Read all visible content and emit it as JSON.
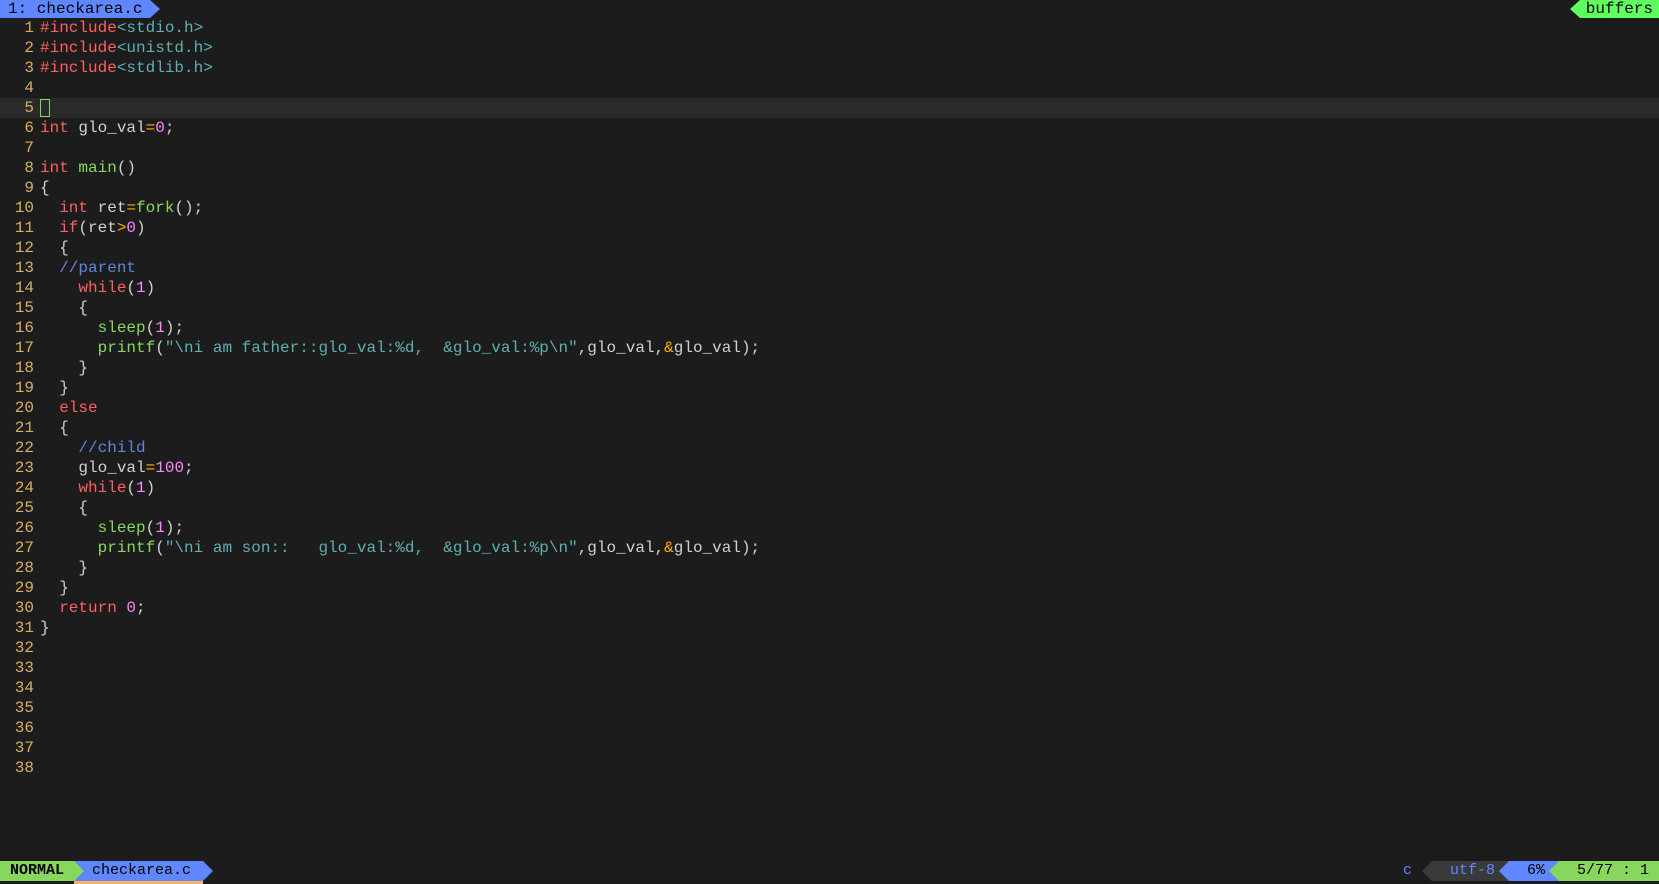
{
  "tabbar": {
    "active_tab": "1: checkarea.c",
    "buffers_label": "buffers"
  },
  "editor": {
    "current_line": 5,
    "lines": [
      {
        "n": 1,
        "tokens": [
          {
            "t": "#include",
            "c": "kw-pre"
          },
          {
            "t": "<stdio.h>",
            "c": "str"
          }
        ]
      },
      {
        "n": 2,
        "tokens": [
          {
            "t": "#include",
            "c": "kw-pre"
          },
          {
            "t": "<unistd.h>",
            "c": "str"
          }
        ]
      },
      {
        "n": 3,
        "tokens": [
          {
            "t": "#include",
            "c": "kw-pre"
          },
          {
            "t": "<stdlib.h>",
            "c": "str"
          }
        ]
      },
      {
        "n": 4,
        "tokens": []
      },
      {
        "n": 5,
        "cursor": true,
        "tokens": []
      },
      {
        "n": 6,
        "tokens": [
          {
            "t": "int",
            "c": "type"
          },
          {
            "t": " ",
            "c": "ident"
          },
          {
            "t": "glo_val",
            "c": "ident"
          },
          {
            "t": "=",
            "c": "op"
          },
          {
            "t": "0",
            "c": "num"
          },
          {
            "t": ";",
            "c": "punct"
          }
        ]
      },
      {
        "n": 7,
        "tokens": []
      },
      {
        "n": 8,
        "tokens": [
          {
            "t": "int",
            "c": "type"
          },
          {
            "t": " ",
            "c": "ident"
          },
          {
            "t": "main",
            "c": "func"
          },
          {
            "t": "()",
            "c": "punct"
          }
        ]
      },
      {
        "n": 9,
        "tokens": [
          {
            "t": "{",
            "c": "punct"
          }
        ]
      },
      {
        "n": 10,
        "tokens": [
          {
            "t": "  ",
            "c": "ident"
          },
          {
            "t": "int",
            "c": "type"
          },
          {
            "t": " ",
            "c": "ident"
          },
          {
            "t": "ret",
            "c": "ident"
          },
          {
            "t": "=",
            "c": "op"
          },
          {
            "t": "fork",
            "c": "func"
          },
          {
            "t": "();",
            "c": "punct"
          }
        ]
      },
      {
        "n": 11,
        "tokens": [
          {
            "t": "  ",
            "c": "ident"
          },
          {
            "t": "if",
            "c": "kw-pre"
          },
          {
            "t": "(ret",
            "c": "ident"
          },
          {
            "t": ">",
            "c": "op"
          },
          {
            "t": "0",
            "c": "num"
          },
          {
            "t": ")",
            "c": "punct"
          }
        ]
      },
      {
        "n": 12,
        "tokens": [
          {
            "t": "  {",
            "c": "punct"
          }
        ]
      },
      {
        "n": 13,
        "tokens": [
          {
            "t": "  ",
            "c": "ident"
          },
          {
            "t": "//parent",
            "c": "comment"
          }
        ]
      },
      {
        "n": 14,
        "tokens": [
          {
            "t": "    ",
            "c": "ident"
          },
          {
            "t": "while",
            "c": "kw-pre"
          },
          {
            "t": "(",
            "c": "punct"
          },
          {
            "t": "1",
            "c": "num"
          },
          {
            "t": ")",
            "c": "punct"
          }
        ]
      },
      {
        "n": 15,
        "tokens": [
          {
            "t": "    {",
            "c": "punct"
          }
        ]
      },
      {
        "n": 16,
        "tokens": [
          {
            "t": "      ",
            "c": "ident"
          },
          {
            "t": "sleep",
            "c": "func"
          },
          {
            "t": "(",
            "c": "punct"
          },
          {
            "t": "1",
            "c": "num"
          },
          {
            "t": ");",
            "c": "punct"
          }
        ]
      },
      {
        "n": 17,
        "tokens": [
          {
            "t": "      ",
            "c": "ident"
          },
          {
            "t": "printf",
            "c": "func"
          },
          {
            "t": "(",
            "c": "punct"
          },
          {
            "t": "\"\\ni am father::glo_val:%d,  &glo_val:%p\\n\"",
            "c": "str"
          },
          {
            "t": ",glo_val,",
            "c": "ident"
          },
          {
            "t": "&",
            "c": "op"
          },
          {
            "t": "glo_val);",
            "c": "ident"
          }
        ]
      },
      {
        "n": 18,
        "tokens": [
          {
            "t": "    }",
            "c": "punct"
          }
        ]
      },
      {
        "n": 19,
        "tokens": [
          {
            "t": "  }",
            "c": "punct"
          }
        ]
      },
      {
        "n": 20,
        "tokens": [
          {
            "t": "  ",
            "c": "ident"
          },
          {
            "t": "else",
            "c": "kw-pre"
          }
        ]
      },
      {
        "n": 21,
        "tokens": [
          {
            "t": "  {",
            "c": "punct"
          }
        ]
      },
      {
        "n": 22,
        "tokens": [
          {
            "t": "    ",
            "c": "ident"
          },
          {
            "t": "//child",
            "c": "comment"
          }
        ]
      },
      {
        "n": 23,
        "tokens": [
          {
            "t": "    glo_val",
            "c": "ident"
          },
          {
            "t": "=",
            "c": "op"
          },
          {
            "t": "100",
            "c": "num"
          },
          {
            "t": ";",
            "c": "punct"
          }
        ]
      },
      {
        "n": 24,
        "tokens": [
          {
            "t": "    ",
            "c": "ident"
          },
          {
            "t": "while",
            "c": "kw-pre"
          },
          {
            "t": "(",
            "c": "punct"
          },
          {
            "t": "1",
            "c": "num"
          },
          {
            "t": ")",
            "c": "punct"
          }
        ]
      },
      {
        "n": 25,
        "tokens": [
          {
            "t": "    {",
            "c": "punct"
          }
        ]
      },
      {
        "n": 26,
        "tokens": [
          {
            "t": "      ",
            "c": "ident"
          },
          {
            "t": "sleep",
            "c": "func"
          },
          {
            "t": "(",
            "c": "punct"
          },
          {
            "t": "1",
            "c": "num"
          },
          {
            "t": ");",
            "c": "punct"
          }
        ]
      },
      {
        "n": 27,
        "tokens": [
          {
            "t": "      ",
            "c": "ident"
          },
          {
            "t": "printf",
            "c": "func"
          },
          {
            "t": "(",
            "c": "punct"
          },
          {
            "t": "\"\\ni am son::   glo_val:%d,  &glo_val:%p\\n\"",
            "c": "str"
          },
          {
            "t": ",glo_val,",
            "c": "ident"
          },
          {
            "t": "&",
            "c": "op"
          },
          {
            "t": "glo_val);",
            "c": "ident"
          }
        ]
      },
      {
        "n": 28,
        "tokens": [
          {
            "t": "    }",
            "c": "punct"
          }
        ]
      },
      {
        "n": 29,
        "tokens": [
          {
            "t": "  }",
            "c": "punct"
          }
        ]
      },
      {
        "n": 30,
        "tokens": [
          {
            "t": "  ",
            "c": "ident"
          },
          {
            "t": "return",
            "c": "kw-pre"
          },
          {
            "t": " ",
            "c": "ident"
          },
          {
            "t": "0",
            "c": "num"
          },
          {
            "t": ";",
            "c": "punct"
          }
        ]
      },
      {
        "n": 31,
        "tokens": [
          {
            "t": "}",
            "c": "punct"
          }
        ]
      },
      {
        "n": 32,
        "tokens": []
      },
      {
        "n": 33,
        "tokens": []
      },
      {
        "n": 34,
        "tokens": []
      },
      {
        "n": 35,
        "tokens": []
      },
      {
        "n": 36,
        "tokens": []
      },
      {
        "n": 37,
        "tokens": []
      },
      {
        "n": 38,
        "tokens": []
      }
    ]
  },
  "statusbar": {
    "mode": "NORMAL",
    "filename": "checkarea.c",
    "filetype": "c",
    "encoding": "utf-8",
    "percent": "6%",
    "position": "5/77 :  1"
  }
}
